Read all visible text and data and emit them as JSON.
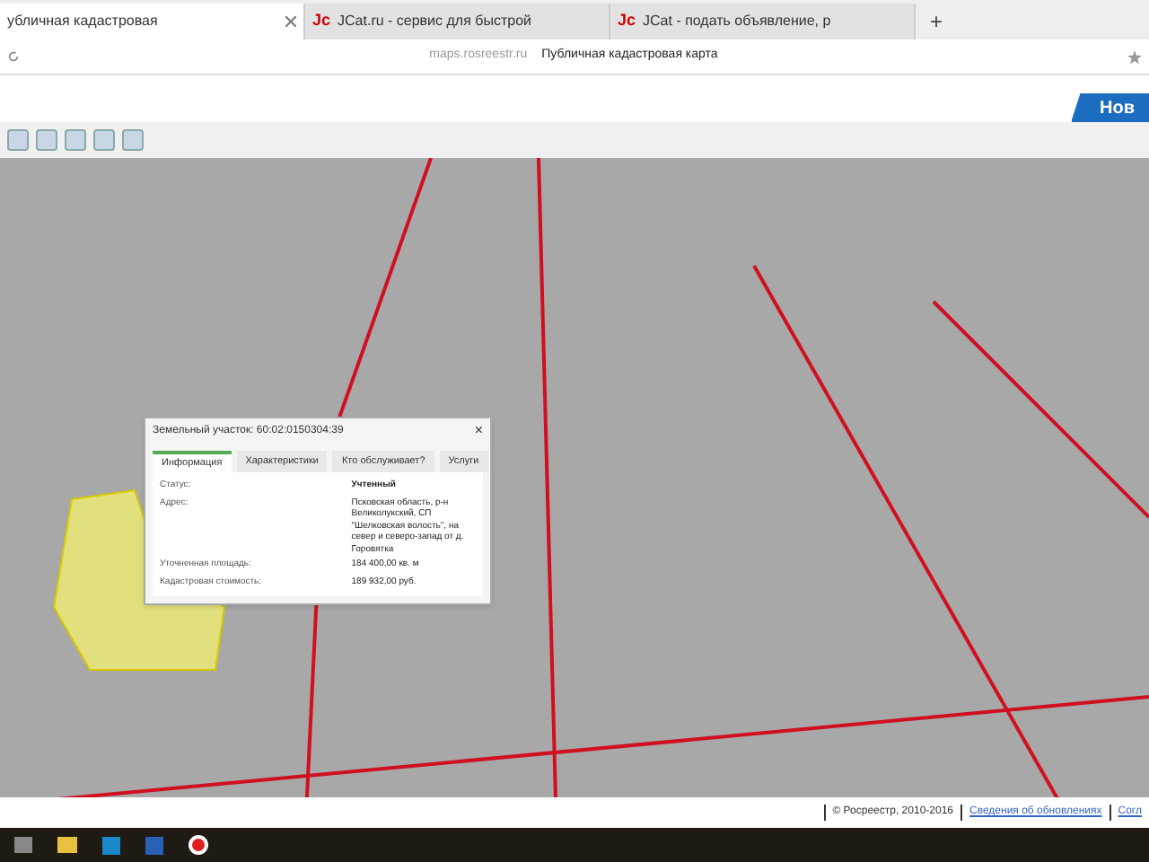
{
  "browser_tabs": [
    {
      "title": "убличная кадастровая",
      "selected": true
    },
    {
      "title": "JCat.ru - сервис для быстрой",
      "selected": false,
      "logo": "Jc"
    },
    {
      "title": "JCat - подать объявление, р",
      "selected": false,
      "logo": "Jc"
    }
  ],
  "new_tab": "+",
  "address": {
    "domain": "maps.rosreestr.ru",
    "title": "Публичная кадастровая карта"
  },
  "header_button": "Нов",
  "popup": {
    "title": "Земельный участок: 60:02:0150304:39",
    "close": "×",
    "tabs": [
      {
        "label": "Информация",
        "selected": true
      },
      {
        "label": "Характеристики",
        "selected": false
      },
      {
        "label": "Кто обслуживает?",
        "selected": false
      },
      {
        "label": "Услуги",
        "selected": false
      }
    ],
    "rows": [
      {
        "label": "Статус:",
        "value": "Учтенный",
        "bold": true
      },
      {
        "label": "Адрес:",
        "value": "Псковская область, р-н Великолукский, СП \"Шелковская волость\", на север и северо-запад от д. Горовятка",
        "bold": false
      },
      {
        "label": "Уточненная площадь:",
        "value": "184 400,00 кв. м",
        "bold": false
      },
      {
        "label": "Кадастровая стоимость:",
        "value": "189 932,00 руб.",
        "bold": false
      }
    ]
  },
  "footer": {
    "copyright": "© Росреестр, 2010-2016",
    "link_1": "Сведения об обновлениях",
    "link_2": "Согл"
  }
}
